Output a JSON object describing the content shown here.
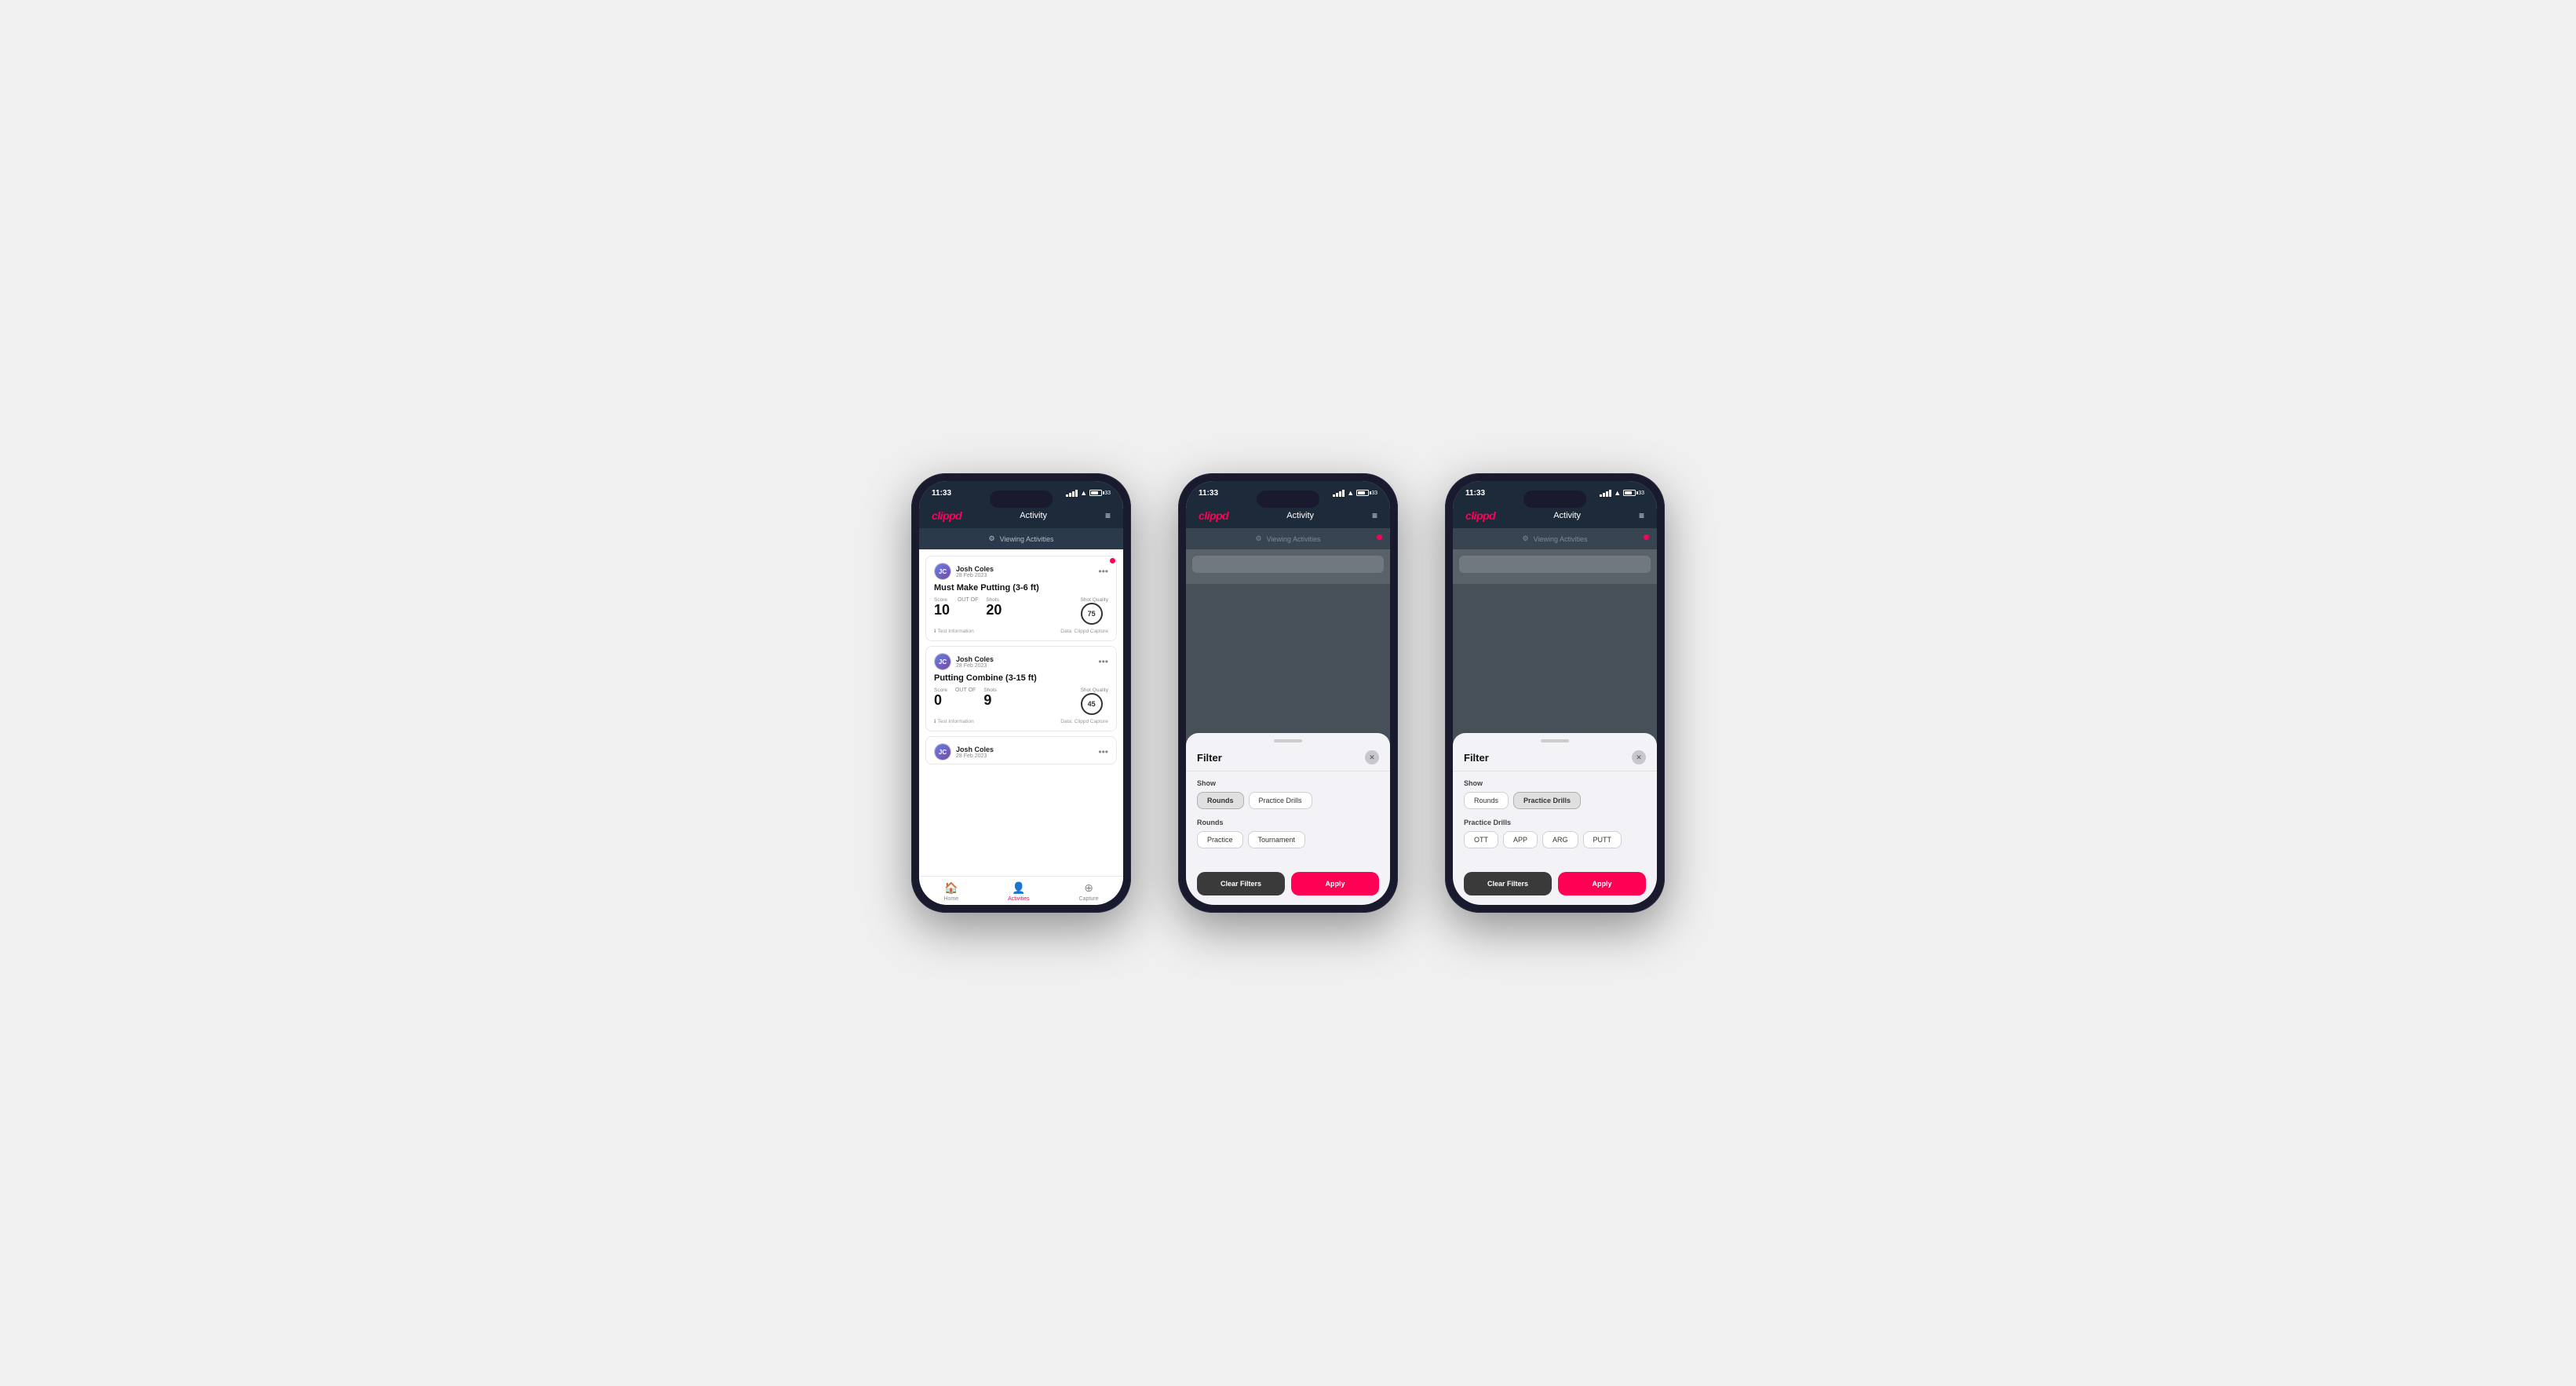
{
  "phones": [
    {
      "id": "phone1",
      "type": "activity-list",
      "statusBar": {
        "time": "11:33",
        "batteryLevel": "33"
      },
      "navBar": {
        "logo": "clippd",
        "title": "Activity",
        "menuIcon": "≡"
      },
      "viewingBar": {
        "text": "Viewing Activities"
      },
      "activities": [
        {
          "user": "Josh Coles",
          "date": "28 Feb 2023",
          "title": "Must Make Putting (3-6 ft)",
          "score": "10",
          "outOf": "20",
          "shots": "20",
          "shotQuality": "75",
          "testInfo": "Test Information",
          "dataSource": "Data: Clippd Capture"
        },
        {
          "user": "Josh Coles",
          "date": "28 Feb 2023",
          "title": "Putting Combine (3-15 ft)",
          "score": "0",
          "outOf": "9",
          "shots": "9",
          "shotQuality": "45",
          "testInfo": "Test Information",
          "dataSource": "Data: Clippd Capture"
        },
        {
          "user": "Josh Coles",
          "date": "28 Feb 2023",
          "title": "",
          "score": "",
          "outOf": "",
          "shots": "",
          "shotQuality": "",
          "testInfo": "",
          "dataSource": ""
        }
      ],
      "bottomNav": [
        {
          "icon": "🏠",
          "label": "Home",
          "active": false
        },
        {
          "icon": "👤",
          "label": "Activities",
          "active": true
        },
        {
          "icon": "➕",
          "label": "Capture",
          "active": false
        }
      ]
    },
    {
      "id": "phone2",
      "type": "filter-rounds",
      "statusBar": {
        "time": "11:33",
        "batteryLevel": "33"
      },
      "navBar": {
        "logo": "clippd",
        "title": "Activity",
        "menuIcon": "≡"
      },
      "viewingBar": {
        "text": "Viewing Activities"
      },
      "filterSheet": {
        "title": "Filter",
        "closeIcon": "✕",
        "showLabel": "Show",
        "showOptions": [
          {
            "label": "Rounds",
            "active": true
          },
          {
            "label": "Practice Drills",
            "active": false
          }
        ],
        "roundsLabel": "Rounds",
        "roundsOptions": [
          {
            "label": "Practice",
            "active": false
          },
          {
            "label": "Tournament",
            "active": false
          }
        ],
        "clearLabel": "Clear Filters",
        "applyLabel": "Apply"
      }
    },
    {
      "id": "phone3",
      "type": "filter-drills",
      "statusBar": {
        "time": "11:33",
        "batteryLevel": "33"
      },
      "navBar": {
        "logo": "clippd",
        "title": "Activity",
        "menuIcon": "≡"
      },
      "viewingBar": {
        "text": "Viewing Activities"
      },
      "filterSheet": {
        "title": "Filter",
        "closeIcon": "✕",
        "showLabel": "Show",
        "showOptions": [
          {
            "label": "Rounds",
            "active": false
          },
          {
            "label": "Practice Drills",
            "active": true
          }
        ],
        "drillsLabel": "Practice Drills",
        "drillsOptions": [
          {
            "label": "OTT",
            "active": false
          },
          {
            "label": "APP",
            "active": false
          },
          {
            "label": "ARG",
            "active": false
          },
          {
            "label": "PUTT",
            "active": false
          }
        ],
        "clearLabel": "Clear Filters",
        "applyLabel": "Apply"
      }
    }
  ]
}
